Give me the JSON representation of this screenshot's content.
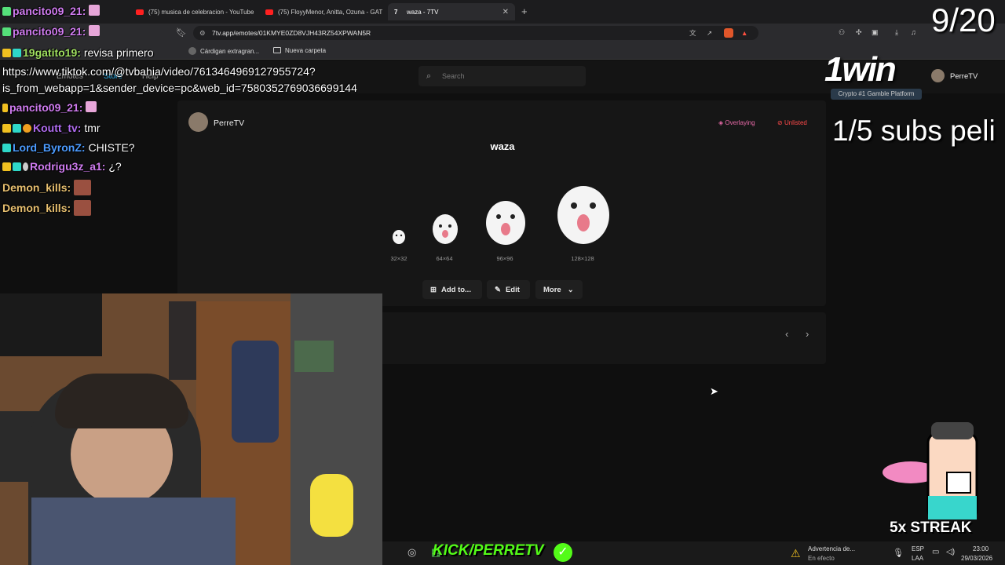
{
  "tabs": [
    {
      "label": "(75) musica de celebracion - YouTube"
    },
    {
      "label": "(75) FloyyMenor, Anitta, Ozuna - GAT"
    },
    {
      "label": "waza - 7TV"
    }
  ],
  "address_bar": {
    "url": "7tv.app/emotes/01KMYE0ZD8VJH43RZ54XPWAN5R"
  },
  "bookmarks": {
    "item1": "Cárdigan extragran...",
    "item2": "Nueva carpeta"
  },
  "site": {
    "nav": [
      "Emotes",
      "Store",
      "Help"
    ],
    "search_placeholder": "Search",
    "user": "PerreTV"
  },
  "emote": {
    "owner": "PerreTV",
    "name": "waza",
    "flags": [
      "Overlaying",
      "Unlisted"
    ],
    "sizes": [
      "32×32",
      "64×64",
      "96×96",
      "128×128"
    ],
    "buttons": {
      "add": "Add to...",
      "edit": "Edit",
      "more": "More"
    }
  },
  "overlay": {
    "counter": "9/20",
    "goal": "1/5 subs peli",
    "sponsor": "1win",
    "sponsor_tagline": "Crypto #1 Gamble Platform",
    "streak": "5x STREAK",
    "kick": "KICK/PERRETV"
  },
  "chat": [
    {
      "user": "pancito09_21:",
      "msg": "",
      "color": "#d07cf0"
    },
    {
      "user": "pancito09_21:",
      "msg": "",
      "color": "#d07cf0"
    },
    {
      "user": "19gatito19:",
      "msg": "revisa primero",
      "color": "#a0e060"
    },
    {
      "user": "",
      "msg": "https://www.tiktok.com/@tvbahia/video/7613464969127955724?",
      "color": "#fff"
    },
    {
      "user": "",
      "msg": "is_from_webapp=1&sender_device=pc&web_id=7580352769036699144",
      "color": "#fff"
    },
    {
      "user": "pancito09_21:",
      "msg": "",
      "color": "#d07cf0"
    },
    {
      "user": "Koutt_tv:",
      "msg": "tmr",
      "color": "#b06cf0"
    },
    {
      "user": "Lord_ByronZ:",
      "msg": "CHISTE?",
      "color": "#4c9cff"
    },
    {
      "user": "Rodrigu3z_a1:",
      "msg": "¿?",
      "color": "#d07cf0"
    },
    {
      "user": "Demon_kills:",
      "msg": "",
      "color": "#e8c070"
    },
    {
      "user": "Demon_kills:",
      "msg": "",
      "color": "#e8c070"
    }
  ],
  "taskbar": {
    "warning": "Advertencia de...",
    "warning_sub": "En efecto",
    "lang1": "ESP",
    "lang2": "LAA",
    "time": "23:00",
    "date": "29/03/2026"
  }
}
